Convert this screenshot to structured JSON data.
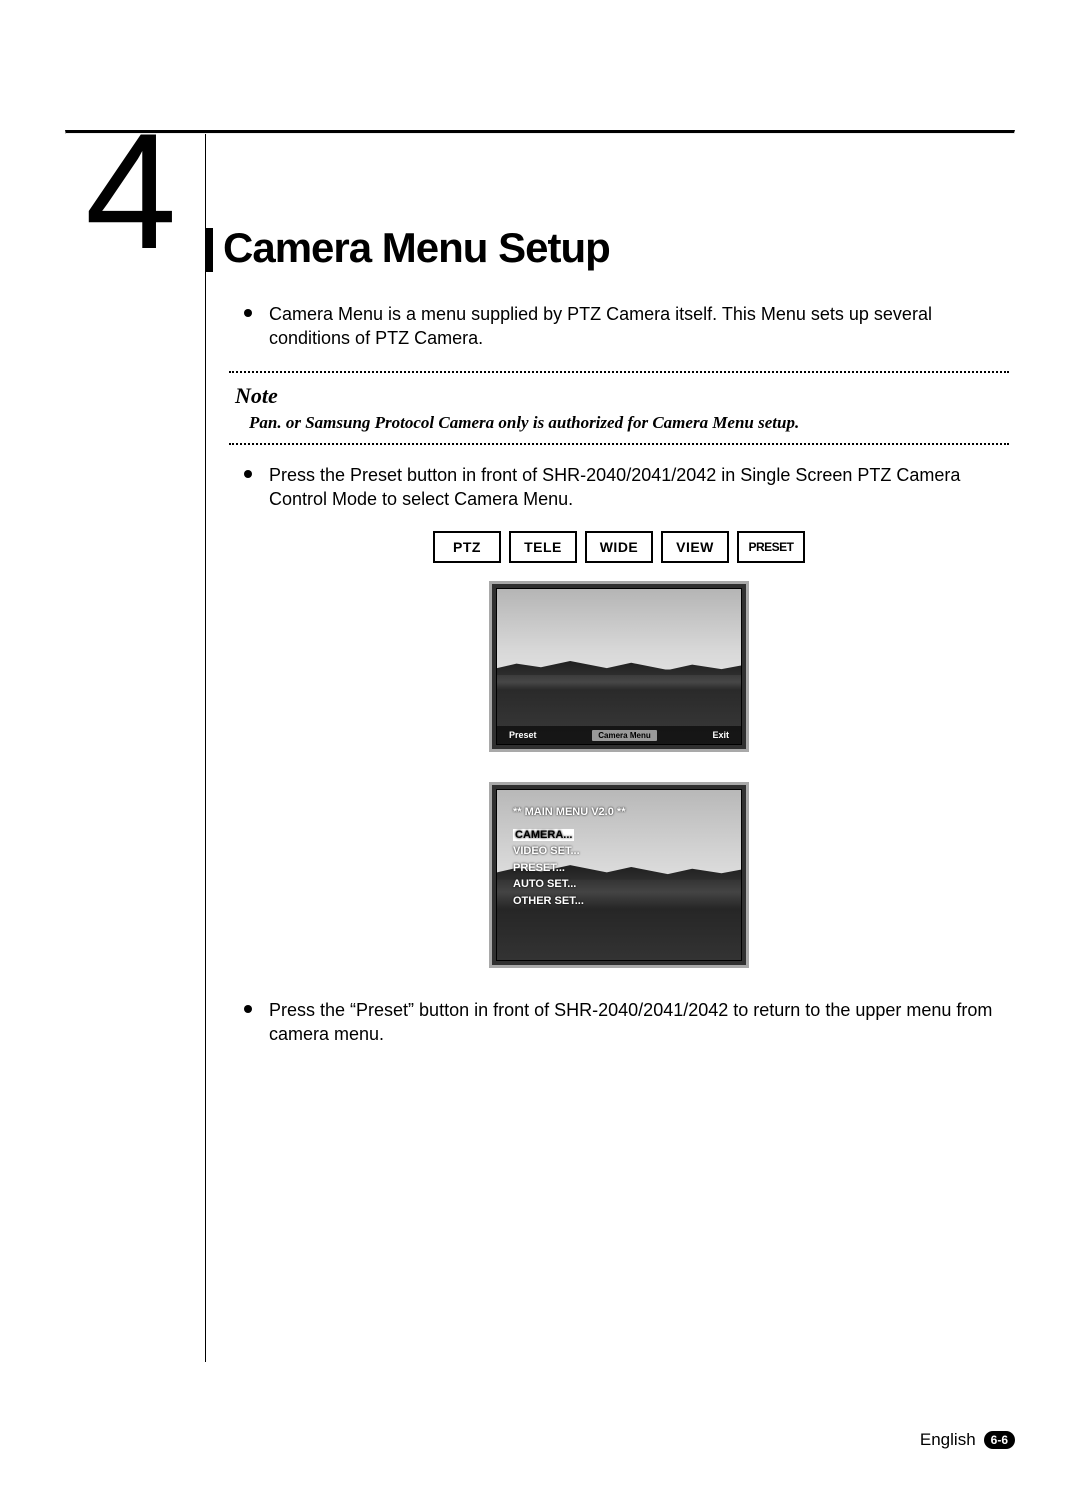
{
  "section": {
    "number": "4",
    "title": "Camera Menu Setup"
  },
  "bullets": {
    "b1": "Camera Menu is a menu supplied by PTZ Camera itself. This Menu sets up several conditions of PTZ Camera.",
    "b2": "Press the Preset button in front of SHR-2040/2041/2042 in Single Screen PTZ Camera Control Mode to select Camera Menu.",
    "b3": "Press the “Preset” button in front of SHR-2040/2041/2042 to return to the upper menu from camera menu."
  },
  "note": {
    "label": "Note",
    "text": "Pan. or Samsung Protocol Camera only is authorized for Camera Menu setup."
  },
  "buttons": {
    "ptz": "PTZ",
    "tele": "TELE",
    "wide": "WIDE",
    "view": "VIEW",
    "preset": "PRESET"
  },
  "osd1": {
    "left": "Preset",
    "center": "Camera Menu",
    "right": "Exit"
  },
  "osd2": {
    "title": "** MAIN MENU V2.0 **",
    "item1": "CAMERA...",
    "item2": "VIDEO SET...",
    "item3": "PRESET...",
    "item4": "AUTO SET...",
    "item5": "OTHER SET..."
  },
  "footer": {
    "lang": "English",
    "page": "6-6"
  }
}
